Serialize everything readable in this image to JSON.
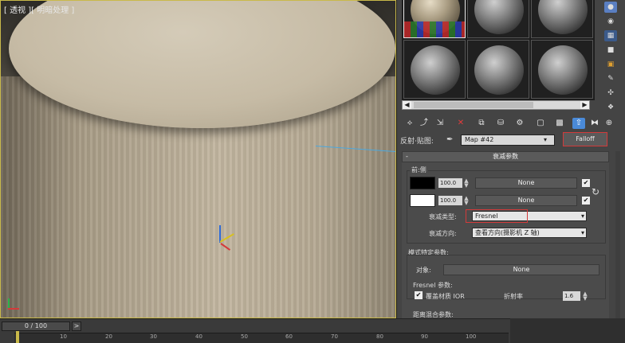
{
  "viewport": {
    "label": "[ 透视 ][ 明暗处理 ]"
  },
  "timeline": {
    "frame": "0 / 100",
    "arrow": ">",
    "ticks": [
      "10",
      "20",
      "30",
      "40",
      "50",
      "60",
      "70",
      "80",
      "90",
      "100"
    ]
  },
  "material_editor": {
    "slot_count": 6,
    "toolbar": {
      "icons": [
        "get-material-icon",
        "put-to-scene-icon",
        "assign-material-icon",
        "reset-icon",
        "make-unique-icon",
        "put-to-library-icon",
        "material-id-icon",
        "show-in-viewport-icon",
        "show-end-result-icon",
        "go-to-parent-icon",
        "go-forward-sibling-icon"
      ]
    },
    "map_row": {
      "label": "反射·贴图:",
      "map_name": "Map #42",
      "type_button": "Falloff"
    },
    "panel": {
      "title": "衰减参数",
      "collapse": "-",
      "group_front_side": "前:侧",
      "row1": {
        "value": "100.0",
        "map": "None",
        "checked": "✔"
      },
      "row2": {
        "value": "100.0",
        "map": "None",
        "checked": "✔"
      },
      "falloff_type_label": "衰减类型:",
      "falloff_type_value": "Fresnel",
      "falloff_dir_label": "衰减方向:",
      "falloff_dir_value": "查看方向(摄影机 Z 轴)",
      "mode_group": "模式特定参数:",
      "object_label": "对象:",
      "object_value": "None",
      "fresnel_label": "Fresnel 参数:",
      "override_label": "覆盖材质 IOR",
      "override_checked": "✔",
      "ior_label": "折射率",
      "ior_value": "1.6",
      "next_group": "距离混合参数:"
    },
    "colors": {
      "front": "#000000",
      "side": "#ffffff",
      "accent": "#d23a3a",
      "highlight": "#4a8ad8"
    }
  }
}
